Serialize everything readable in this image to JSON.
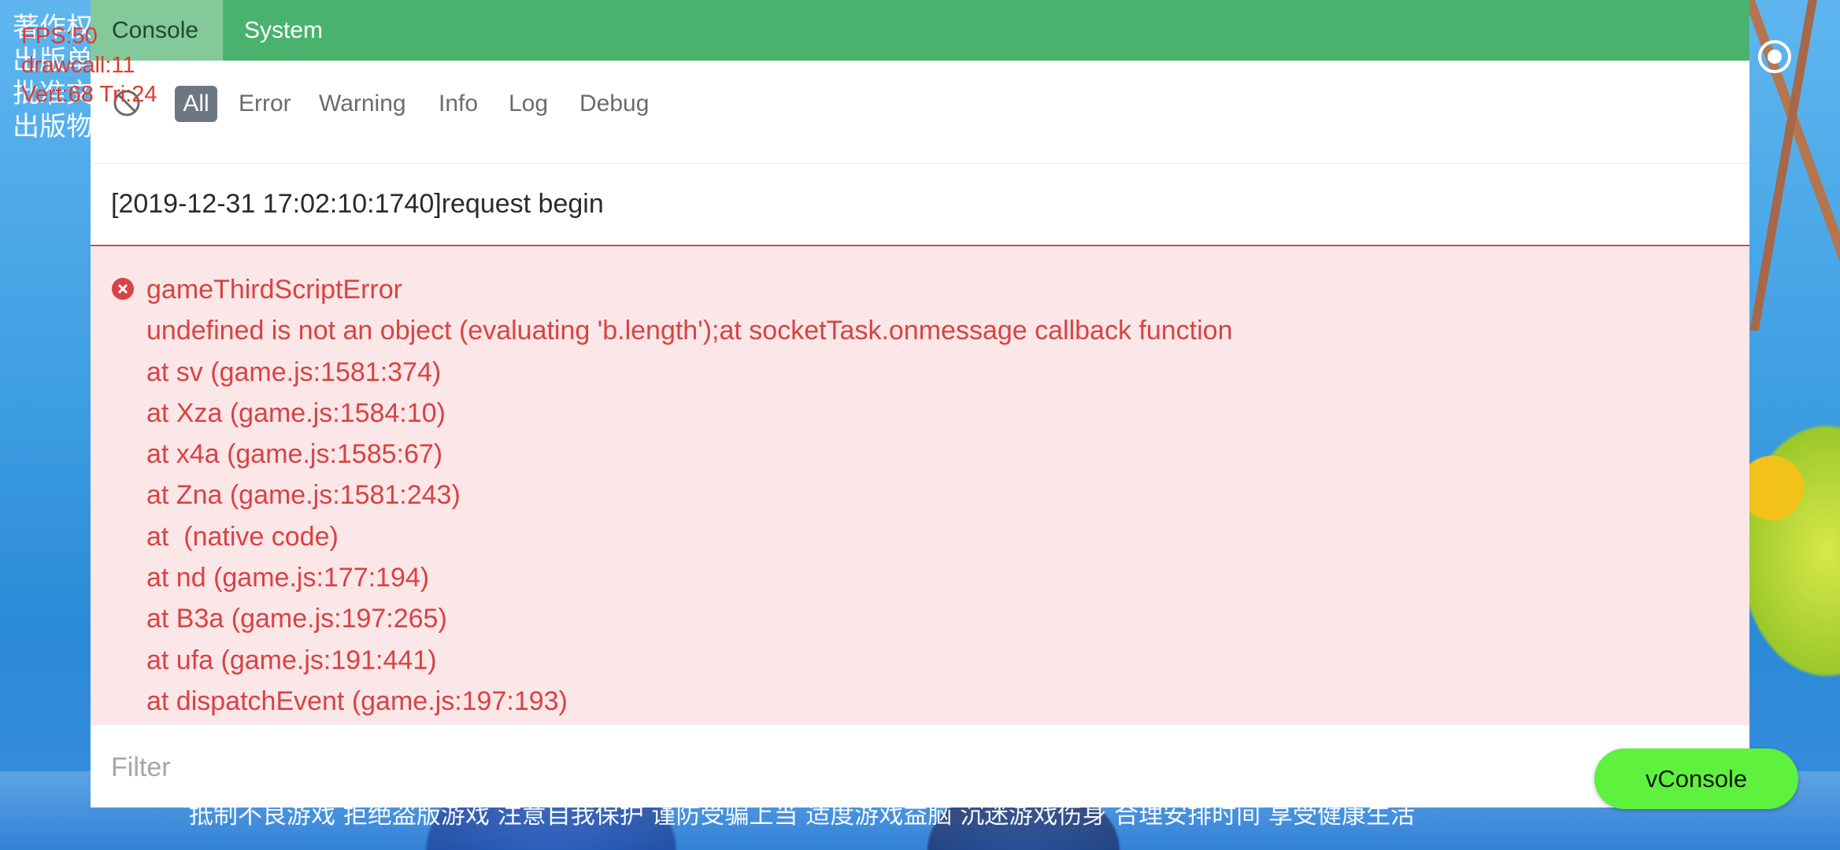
{
  "game": {
    "side_text": [
      "著作权",
      "出版单位",
      "批准文号",
      "出版物号"
    ],
    "health_notice": "抵制不良游戏 拒绝盗版游戏 注意自我保护 谨防受骗上当 适度游戏益脑 沉迷游戏伤身 合理安排时间 享受健康生活"
  },
  "stats": {
    "fps": "FPS:50",
    "drawcall": "drawcall:11",
    "vert": "Vert:68 Tri:24"
  },
  "vconsole": {
    "tabs": [
      {
        "label": "Console",
        "active": true
      },
      {
        "label": "System",
        "active": false
      }
    ],
    "filters": [
      {
        "label": "All",
        "active": true
      },
      {
        "label": "Error"
      },
      {
        "label": "Warning"
      },
      {
        "label": "Info"
      },
      {
        "label": "Log"
      },
      {
        "label": "Debug"
      }
    ],
    "logs": {
      "request": "[2019-12-31 17:02:10:1740]request begin",
      "error_lines": [
        "gameThirdScriptError",
        "undefined is not an object (evaluating 'b.length');at socketTask.onmessage callback function",
        "at sv (game.js:1581:374)",
        "at Xza (game.js:1584:10)",
        "at x4a (game.js:1585:67)",
        "at Zna (game.js:1581:243)",
        "at  (native code)",
        "at nd (game.js:177:194)",
        "at B3a (game.js:197:265)",
        "at ufa (game.js:191:441)",
        "at dispatchEvent (game.js:197:193)"
      ]
    },
    "filter_placeholder": "Filter",
    "toggle_button": "vConsole"
  },
  "colors": {
    "tabbar": "#49b36e",
    "error_bg": "#fbe6e8",
    "error_text": "#d84343",
    "toggle_button": "#5ef13e",
    "stats_text": "#e23a2e"
  },
  "icons": [
    "clear-icon",
    "error-icon",
    "record-icon"
  ]
}
